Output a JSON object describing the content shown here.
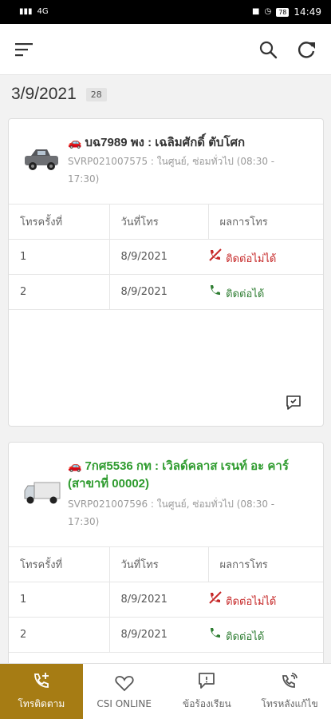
{
  "status_bar": {
    "time": "14:49",
    "battery": "78",
    "network": "4G"
  },
  "header": {
    "menu_icon": "menu-lines-icon",
    "search_icon": "search-icon",
    "refresh_icon": "refresh-icon"
  },
  "date_group": {
    "date": "3/9/2021",
    "count": "28"
  },
  "table_headers": {
    "col1": "โทรครั้งที่",
    "col2": "วันที่โทร",
    "col3": "ผลการโทร"
  },
  "cards": [
    {
      "vehicle": "pickup-truck",
      "plate_line1": "บฉ7989 พง : เฉลิมศักดิ์ ตับโศก",
      "plate_line2": "",
      "plate_color": "#222222",
      "meta_line1": "SVRP021007575 : ในศูนย์, ซ่อมทั่วไป (08:30 -",
      "meta_line2": "17:30)",
      "calls": [
        {
          "no": "1",
          "date": "8/9/2021",
          "result": "ติดต่อไม่ได้",
          "status": "fail"
        },
        {
          "no": "2",
          "date": "8/9/2021",
          "result": "ติดต่อได้",
          "status": "ok"
        }
      ]
    },
    {
      "vehicle": "box-truck",
      "plate_line1": "7กศ5536 กท : เวิลด์คลาส เรนท์ อะ คาร์",
      "plate_line2": "(สาขาที่ 00002)",
      "plate_color": "#2e9b2e",
      "meta_line1": "SVRP021007596 : ในศูนย์, ซ่อมทั่วไป (08:30 -",
      "meta_line2": "17:30)",
      "calls": [
        {
          "no": "1",
          "date": "8/9/2021",
          "result": "ติดต่อไม่ได้",
          "status": "fail"
        },
        {
          "no": "2",
          "date": "8/9/2021",
          "result": "ติดต่อได้",
          "status": "ok"
        }
      ]
    }
  ],
  "bottom_nav": [
    {
      "label": "โทรติดตาม",
      "icon": "phone-add-icon",
      "active": true
    },
    {
      "label": "CSI ONLINE",
      "icon": "heart-icon",
      "active": false
    },
    {
      "label": "ข้อร้องเรียน",
      "icon": "comment-icon",
      "active": false
    },
    {
      "label": "โทรหลังแก้ไข",
      "icon": "phone-ring-icon",
      "active": false
    }
  ],
  "colors": {
    "accent": "#a67c14",
    "success": "#2e7d32",
    "error": "#c62828"
  }
}
